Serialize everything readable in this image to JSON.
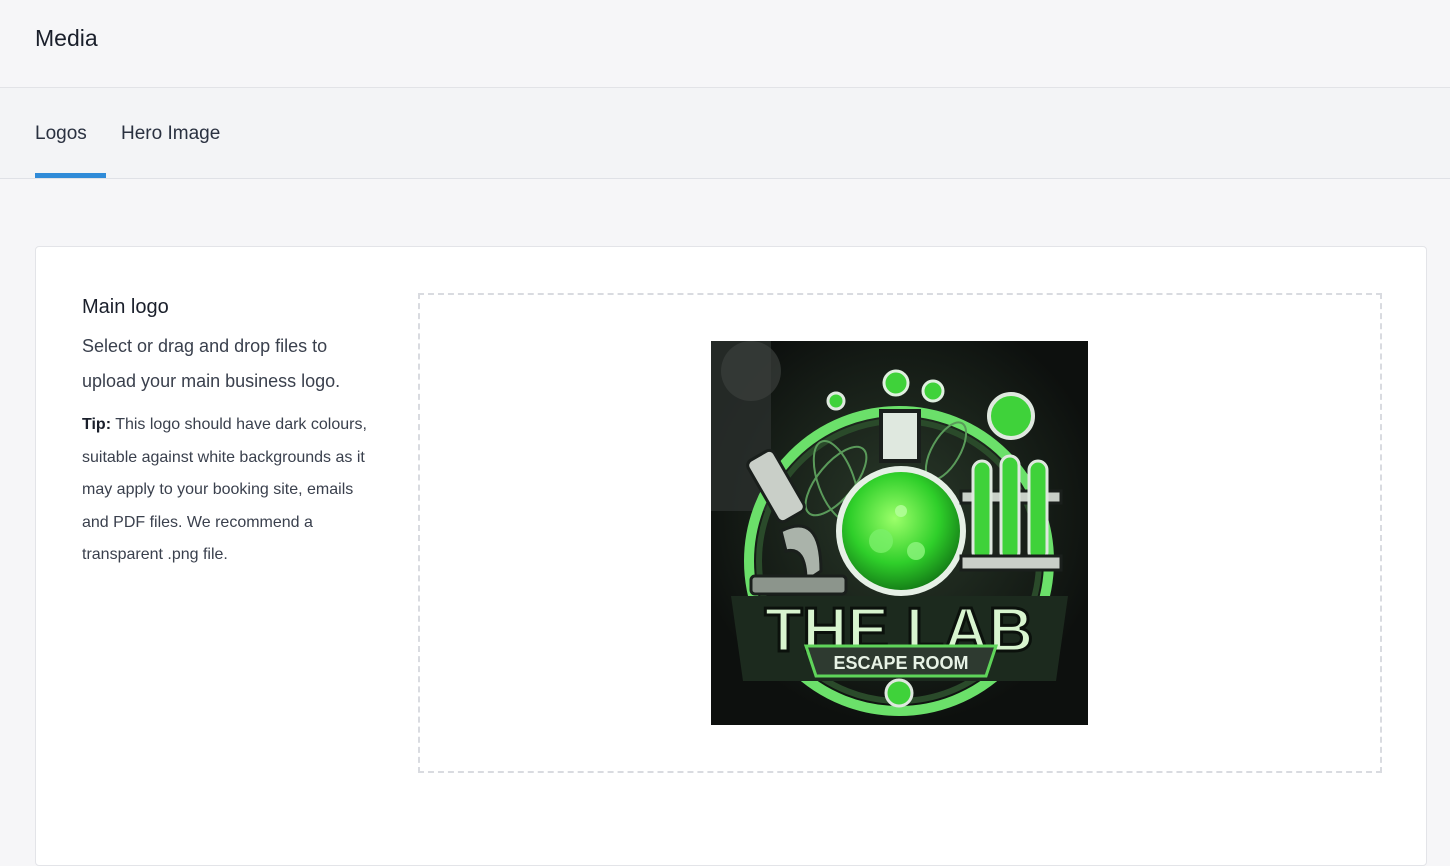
{
  "header": {
    "title": "Media"
  },
  "tabs": [
    {
      "label": "Logos",
      "active": true
    },
    {
      "label": "Hero Image",
      "active": false
    }
  ],
  "main_logo": {
    "heading": "Main logo",
    "lead": "Select or drag and drop files to upload your main business logo.",
    "tip_label": "Tip:",
    "tip_text": "This logo should have dark colours, suitable against white backgrounds as it may apply to your booking site, emails and PDF files. We recommend a transparent .png file.",
    "logo_text_main": "THE LAB",
    "logo_text_sub": "ESCAPE ROOM"
  },
  "colors": {
    "accent": "#2f8bd8",
    "logo_green": "#3fd23a",
    "logo_dark": "#121614"
  }
}
